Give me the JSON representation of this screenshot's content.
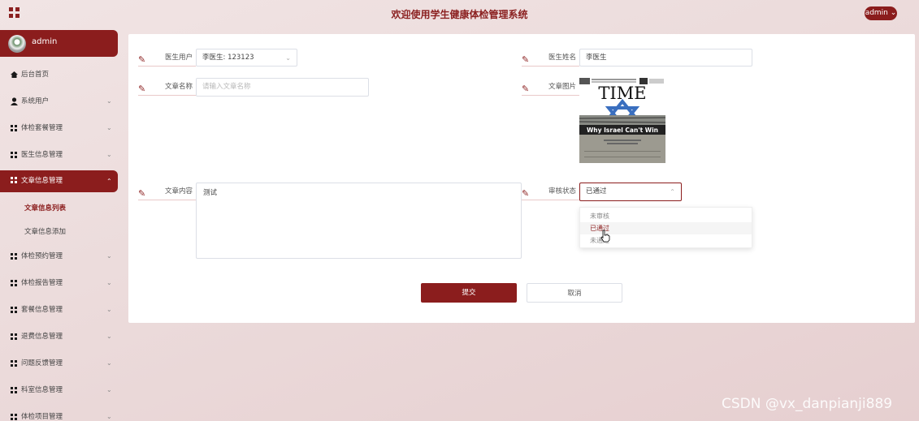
{
  "header": {
    "title": "欢迎使用学生健康体检管理系统",
    "user_menu": "admin"
  },
  "sidebar": {
    "username": "admin",
    "items": [
      {
        "label": "后台首页"
      },
      {
        "label": "系统用户"
      },
      {
        "label": "体检套餐管理"
      },
      {
        "label": "医生信息管理"
      },
      {
        "label": "文章信息管理"
      },
      {
        "label": "体检预约管理"
      },
      {
        "label": "体检报告管理"
      },
      {
        "label": "套餐信息管理"
      },
      {
        "label": "退费信息管理"
      },
      {
        "label": "问题反馈管理"
      },
      {
        "label": "科室信息管理"
      },
      {
        "label": "体检项目管理"
      }
    ],
    "subitems": [
      {
        "label": "文章信息列表"
      },
      {
        "label": "文章信息添加"
      }
    ]
  },
  "form": {
    "doctor_user_label": "医生用户",
    "doctor_user_value": "李医生: 123123",
    "doctor_name_label": "医生姓名",
    "doctor_name_value": "李医生",
    "article_name_label": "文章名称",
    "article_name_placeholder": "请输入文章名称",
    "article_image_label": "文章图片",
    "article_content_label": "文章内容",
    "article_content_value": "测试",
    "review_status_label": "审核状态",
    "review_status_value": "已通过",
    "review_options": [
      "未审核",
      "已通过",
      "未通过"
    ],
    "submit_label": "提交",
    "cancel_label": "取消"
  },
  "cover_image": {
    "masthead": "TIME",
    "headline": "Why Israel Can't Win"
  },
  "watermark": "CSDN @vx_danpianji889",
  "colors": {
    "accent": "#8b1d1d"
  }
}
